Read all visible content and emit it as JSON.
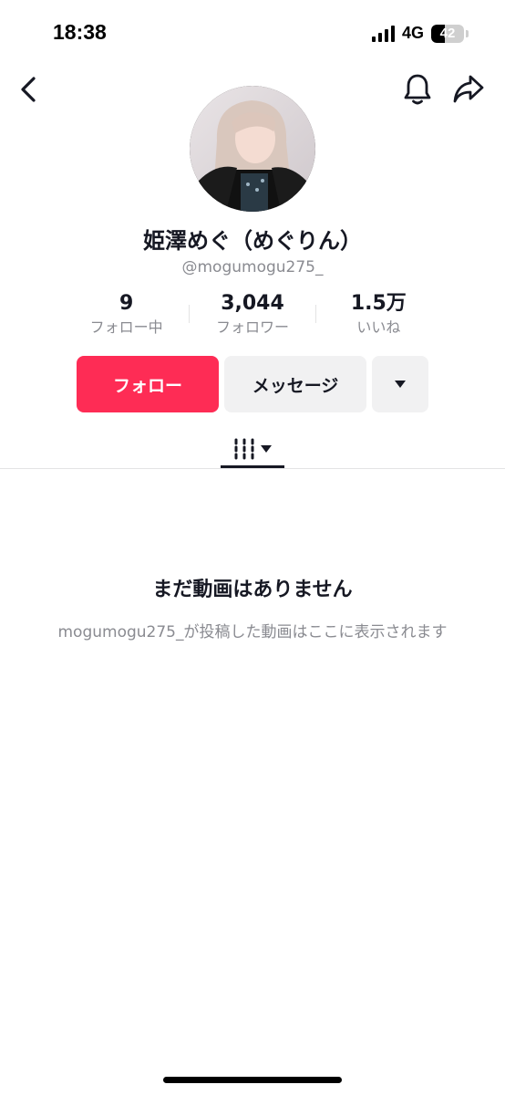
{
  "status_bar": {
    "time": "18:38",
    "network": "4G",
    "battery": "42",
    "battery_level": 0.42,
    "signal_bars": 4
  },
  "nav": {
    "back_icon": "chevron-left-icon",
    "bell_icon": "bell-icon",
    "share_icon": "share-arrow-icon"
  },
  "profile": {
    "avatar": "avatar-photo",
    "display_name": "姫澤めぐ（めぐりん）",
    "username": "@mogumogu275_"
  },
  "stats": [
    {
      "value": "9",
      "label": "フォロー中"
    },
    {
      "value": "3,044",
      "label": "フォロワー"
    },
    {
      "value": "1.5万",
      "label": "いいね"
    }
  ],
  "actions": {
    "follow_label": "フォロー",
    "message_label": "メッセージ",
    "more_icon": "caret-down-icon"
  },
  "tabs": {
    "videos_icon": "grid-lines-icon",
    "dropdown_icon": "caret-down-icon"
  },
  "empty_state": {
    "title": "まだ動画はありません",
    "description": "mogumogu275_が投稿した動画はここに表示されます"
  },
  "colors": {
    "accent": "#fe2c55",
    "text_primary": "#161823",
    "text_secondary": "#8a8b91",
    "button_bg": "#f1f1f2"
  }
}
